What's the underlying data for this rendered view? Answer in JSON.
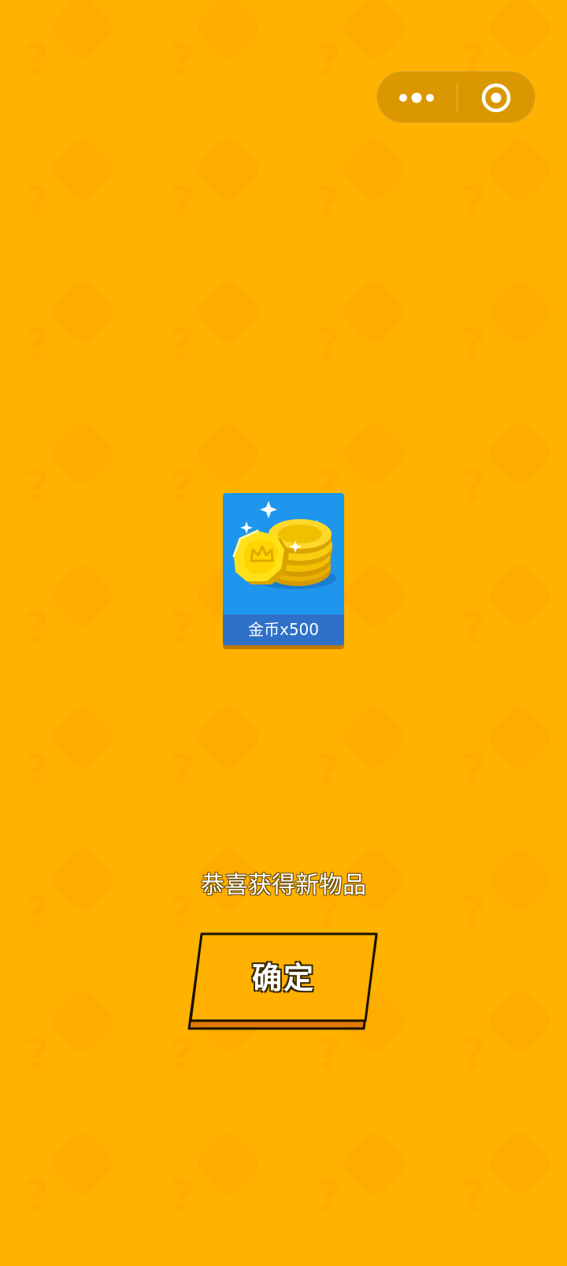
{
  "capsule": {
    "more_icon": "more-dots-icon",
    "close_icon": "target-circle-icon"
  },
  "reward": {
    "icon": "gold-coins-icon",
    "label": "金币x500"
  },
  "message": "恭喜获得新物品",
  "confirm": {
    "label": "确定"
  },
  "colors": {
    "background": "#FFB200",
    "card": "#1E96EE",
    "card_label": "#2F70C9",
    "button_fill": "#FFB000",
    "button_edge": "#E07A00"
  }
}
